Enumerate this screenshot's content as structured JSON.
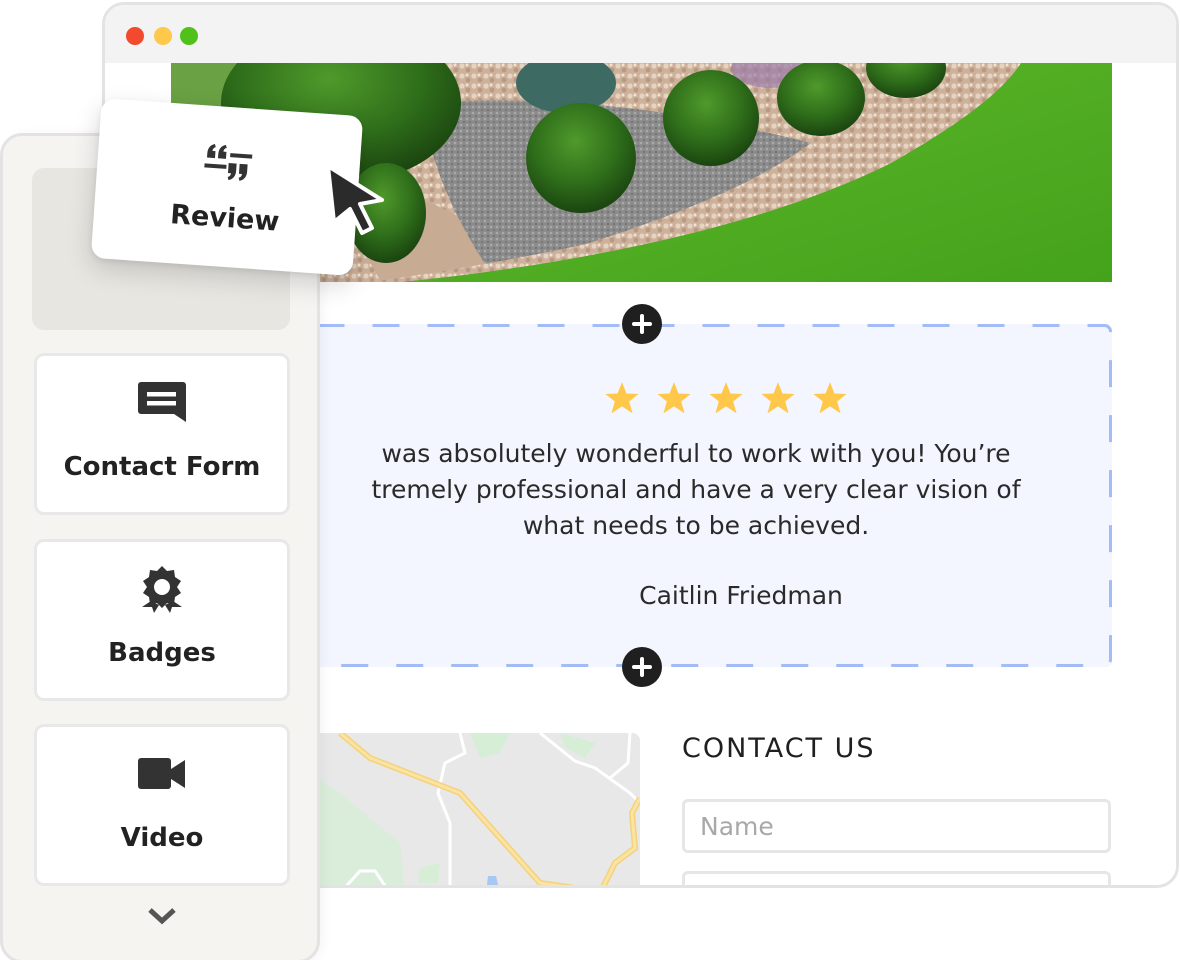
{
  "window": {
    "controls": [
      {
        "name": "close",
        "color": "#f24a2e"
      },
      {
        "name": "minimize",
        "color": "#fec84a"
      },
      {
        "name": "maximize",
        "color": "#4fc11a"
      }
    ]
  },
  "hero": {
    "image": "garden-landscaping-photo"
  },
  "review": {
    "rating": 5,
    "max_rating": 5,
    "star_color": "#ffc84a",
    "quote_lines": [
      "was absolutely wonderful to work with you! You’re",
      "tremely professional and have a very clear vision of",
      "what needs to be achieved."
    ],
    "author": "Caitlin Friedman",
    "border_color": "#a3bcf8",
    "background": "#f3f6fe"
  },
  "add_section": {
    "icon": "plus-icon"
  },
  "map": {
    "image": "street-map"
  },
  "contact": {
    "title": "CONTACT US",
    "name_placeholder": "Name",
    "second_field_placeholder": ""
  },
  "panel": {
    "items": [
      {
        "label": "Contact Form",
        "icon": "message-icon"
      },
      {
        "label": "Badges",
        "icon": "badge-icon"
      },
      {
        "label": "Video",
        "icon": "video-icon"
      }
    ],
    "more_icon": "chevron-down-icon"
  },
  "drag_card": {
    "label": "Review",
    "icon": "quote-icon"
  }
}
